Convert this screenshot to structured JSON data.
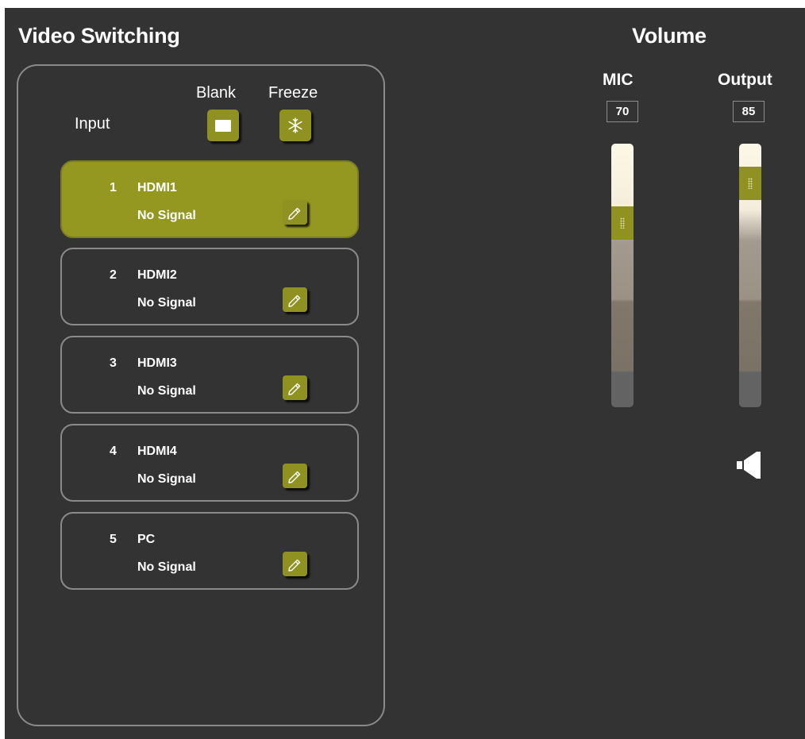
{
  "video_switching": {
    "title": "Video Switching",
    "input_label": "Input",
    "blank_label": "Blank",
    "freeze_label": "Freeze",
    "inputs": [
      {
        "number": "1",
        "name": "HDMI1",
        "status": "No Signal",
        "selected": true
      },
      {
        "number": "2",
        "name": "HDMI2",
        "status": "No Signal",
        "selected": false
      },
      {
        "number": "3",
        "name": "HDMI3",
        "status": "No Signal",
        "selected": false
      },
      {
        "number": "4",
        "name": "HDMI4",
        "status": "No Signal",
        "selected": false
      },
      {
        "number": "5",
        "name": "PC",
        "status": "No Signal",
        "selected": false
      }
    ]
  },
  "volume": {
    "title": "Volume",
    "mic": {
      "label": "MIC",
      "value": "70"
    },
    "output": {
      "label": "Output",
      "value": "85"
    },
    "mute_icon": "speaker-icon"
  },
  "icons": {
    "blank": "blank-square-icon",
    "freeze": "snowflake-icon",
    "edit": "pencil-icon"
  },
  "colors": {
    "accent": "#8f9220",
    "selected_card": "#949821",
    "background": "#333333",
    "border": "#8a8a8a"
  }
}
